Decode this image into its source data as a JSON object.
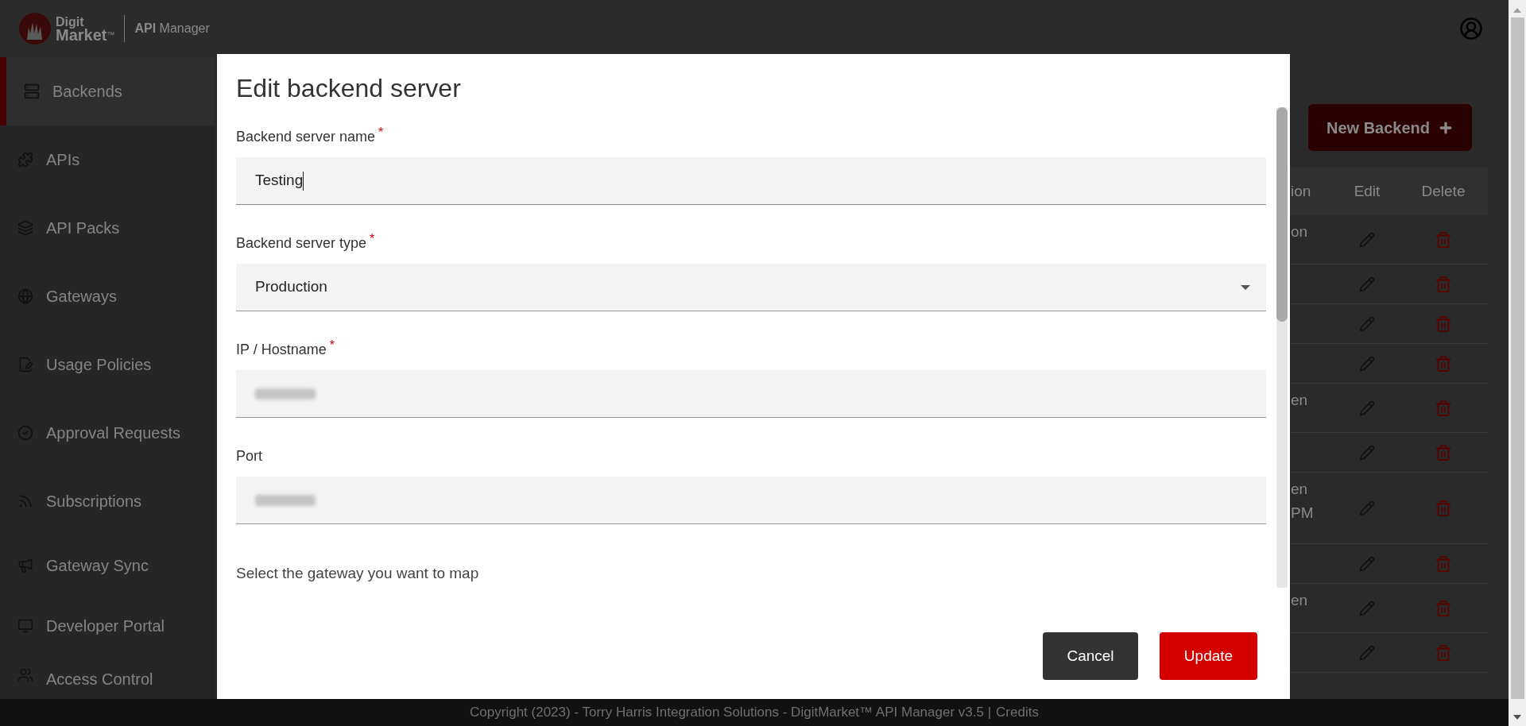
{
  "header": {
    "logo_top": "Digit",
    "logo_bottom": "Market",
    "logo_mark": "™",
    "product_bold": "API",
    "product": "Manager"
  },
  "sidebar": {
    "items": [
      {
        "label": "Backends",
        "selected": true
      },
      {
        "label": "APIs",
        "selected": false
      },
      {
        "label": "API Packs",
        "selected": false
      },
      {
        "label": "Gateways",
        "selected": false
      },
      {
        "label": "Usage Policies",
        "selected": false
      },
      {
        "label": "Approval Requests",
        "selected": false
      },
      {
        "label": "Subscriptions",
        "selected": false
      },
      {
        "label": "Gateway Sync",
        "selected": false
      },
      {
        "label": "Developer Portal",
        "selected": false
      },
      {
        "label": "Access Control",
        "selected": false
      }
    ]
  },
  "main": {
    "new_button": "New Backend",
    "table": {
      "columns": [
        "ion",
        "Edit",
        "Delete"
      ],
      "rows": [
        {
          "column_1": [
            "on"
          ]
        },
        {
          "column_1": []
        },
        {
          "column_1": []
        },
        {
          "column_1": []
        },
        {
          "column_1": [
            "en"
          ]
        },
        {
          "column_1": []
        },
        {
          "column_1": [
            "en",
            "PM"
          ]
        },
        {
          "column_1": []
        },
        {
          "column_1": [
            "en"
          ]
        },
        {
          "column_1": []
        }
      ]
    }
  },
  "modal": {
    "title": "Edit backend server",
    "fields": [
      {
        "kind": "text",
        "label": "Backend server name",
        "required_mark": "*",
        "value": "Testing",
        "focused": true,
        "blurred": false
      },
      {
        "kind": "select",
        "label": "Backend server type",
        "required_mark": "*",
        "value": "Production"
      },
      {
        "kind": "text",
        "label": "IP / Hostname",
        "required_mark": "*",
        "focused": false,
        "blurred": true
      },
      {
        "kind": "text",
        "label": "Port",
        "focused": false,
        "blurred": true
      }
    ],
    "section_label": "Select the gateway you want to map",
    "buttons": [
      {
        "kind": "secondary",
        "label": "Cancel"
      },
      {
        "kind": "primary",
        "label": "Update"
      }
    ]
  },
  "footer": {
    "text": "Copyright (2023) - Torry Harris Integration Solutions - DigitMarket™ API Manager v3.5 |",
    "link": "Credits"
  }
}
